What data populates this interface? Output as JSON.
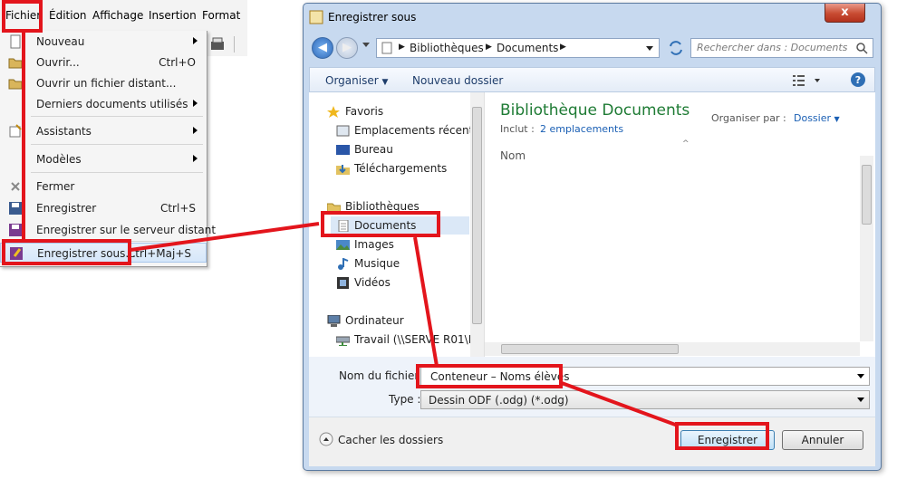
{
  "app": {
    "menubar": [
      "Fichier",
      "Édition",
      "Affichage",
      "Insertion",
      "Format"
    ],
    "file_menu": [
      {
        "label": "Nouveau",
        "shortcut": "",
        "submenu": true,
        "icon": "new-doc-icon"
      },
      {
        "label": "Ouvrir...",
        "shortcut": "Ctrl+O",
        "submenu": false,
        "icon": "open-folder-icon"
      },
      {
        "label": "Ouvrir un fichier distant...",
        "shortcut": "",
        "submenu": false,
        "icon": "remote-folder-icon"
      },
      {
        "label": "Derniers documents utilisés",
        "shortcut": "",
        "submenu": true,
        "icon": ""
      },
      {
        "label": "Assistants",
        "shortcut": "",
        "submenu": true,
        "icon": "wizard-icon"
      },
      {
        "label": "Modèles",
        "shortcut": "",
        "submenu": true,
        "icon": ""
      },
      {
        "label": "Fermer",
        "shortcut": "",
        "submenu": false,
        "icon": "close-x-icon"
      },
      {
        "label": "Enregistrer",
        "shortcut": "Ctrl+S",
        "submenu": false,
        "icon": "save-icon"
      },
      {
        "label": "Enregistrer sur le serveur distant",
        "shortcut": "",
        "submenu": false,
        "icon": "save-remote-icon"
      },
      {
        "label": "Enregistrer sous...",
        "shortcut": "Ctrl+Maj+S",
        "submenu": false,
        "icon": "save-as-icon"
      }
    ]
  },
  "dialog": {
    "title": "Enregistrer sous",
    "close_label": "x",
    "address": [
      "Bibliothèques",
      "Documents"
    ],
    "search_placeholder": "Rechercher dans : Documents",
    "toolbar": {
      "organize": "Organiser",
      "new_folder": "Nouveau dossier"
    },
    "nav": {
      "favorites": "Favoris",
      "favorite_items": [
        "Emplacements récents",
        "Bureau",
        "Téléchargements"
      ],
      "libraries": "Bibliothèques",
      "library_items": [
        "Documents",
        "Images",
        "Musique",
        "Vidéos"
      ],
      "computer": "Ordinateur",
      "computer_items": [
        "Travail (\\\\SERVE R01\\D"
      ]
    },
    "content": {
      "title": "Bibliothèque Documents",
      "includes_label": "Inclut :",
      "includes_link": "2 emplacements",
      "arrange_label": "Organiser par :",
      "arrange_value": "Dossier",
      "column_name": "Nom"
    },
    "filename_label": "Nom du fichier :",
    "filename_value": "Conteneur – Noms élèves",
    "type_label": "Type :",
    "type_value": "Dessin ODF (.odg) (*.odg)",
    "hide_folders": "Cacher les dossiers",
    "save_button": "Enregistrer",
    "cancel_button": "Annuler"
  },
  "colors": {
    "highlight_red": "#e3151c",
    "library_title_green": "#1e7b34",
    "link_blue": "#1a5fb4"
  }
}
